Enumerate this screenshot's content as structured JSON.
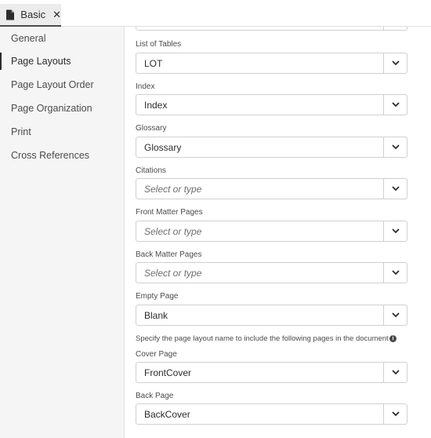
{
  "tab": {
    "label": "Basic",
    "close_glyph": "✕",
    "file_icon": "file-icon"
  },
  "sidebar": {
    "items": [
      {
        "label": "General",
        "active": false
      },
      {
        "label": "Page Layouts",
        "active": true
      },
      {
        "label": "Page Layout Order",
        "active": false
      },
      {
        "label": "Page Organization",
        "active": false
      },
      {
        "label": "Print",
        "active": false
      },
      {
        "label": "Cross References",
        "active": false
      }
    ]
  },
  "fields": {
    "list_of_tables": {
      "label": "List of Tables",
      "value": "LOT"
    },
    "index": {
      "label": "Index",
      "value": "Index"
    },
    "glossary": {
      "label": "Glossary",
      "value": "Glossary"
    },
    "citations": {
      "label": "Citations",
      "placeholder": "Select or type"
    },
    "front_matter": {
      "label": "Front Matter Pages",
      "placeholder": "Select or type"
    },
    "back_matter": {
      "label": "Back Matter Pages",
      "placeholder": "Select or type"
    },
    "empty_page": {
      "label": "Empty Page",
      "value": "Blank"
    },
    "cover_page": {
      "label": "Cover Page",
      "value": "FrontCover"
    },
    "back_page": {
      "label": "Back Page",
      "value": "BackCover"
    }
  },
  "info": {
    "text": "Specify the page layout name to include the following pages in the document",
    "icon": "info-icon"
  },
  "colors": {
    "sidebar_bg": "#f5f5f5",
    "active_indicator": "#2c2c2c",
    "border": "#d0d0d0"
  }
}
